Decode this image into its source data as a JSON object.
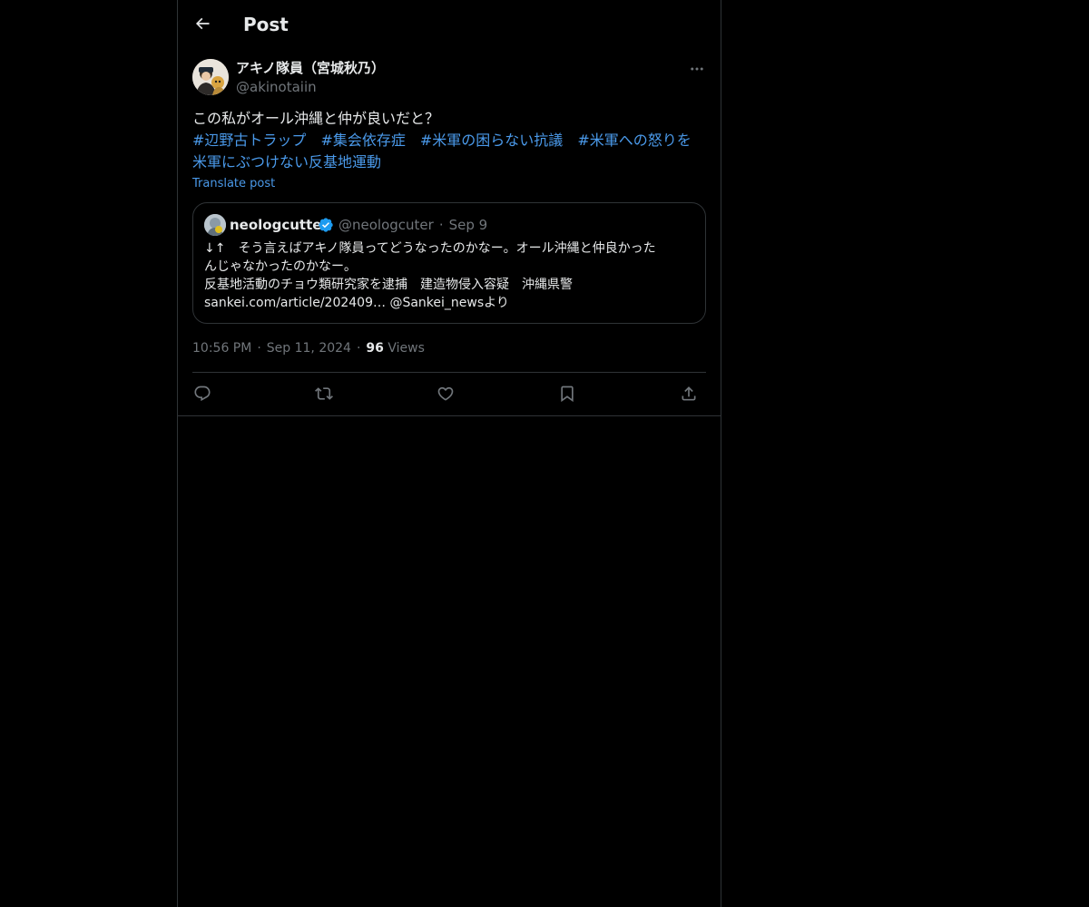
{
  "header": {
    "title": "Post"
  },
  "post": {
    "display_name": "アキノ隊員（宮城秋乃）",
    "handle": "@akinotaiin",
    "text_line1": "この私がオール沖縄と仲が良いだと？",
    "hashtags": [
      "#辺野古トラップ",
      "#集会依存症",
      "#米軍の困らない抗議",
      "#米軍への怒りを米軍にぶつけない反基地運動"
    ],
    "hashtag_last_part1": "#米軍への怒りを",
    "hashtag_last_part2": "米軍にぶつけない反基地運動",
    "translate_label": "Translate post",
    "time": "10:56 PM",
    "date": "Sep 11, 2024",
    "views_count": "96",
    "views_label": "Views"
  },
  "quote": {
    "name": "neologcutter",
    "handle": "@neologcuter",
    "date": "Sep 9",
    "line1": "↓↑　そう言えばアキノ隊員ってどうなったのかなー。オール沖縄と仲良かった",
    "line2": "んじゃなかったのかなー。",
    "line3": "反基地活動のチョウ類研究家を逮捕　建造物侵入容疑　沖縄県警",
    "line4": "sankei.com/article/202409… @Sankei_newsより"
  },
  "icons": {
    "back": "arrow-left-icon",
    "more": "more-horizontal-icon",
    "reply": "reply-icon",
    "repost": "repost-icon",
    "like": "heart-icon",
    "bookmark": "bookmark-icon",
    "share": "share-icon",
    "verified": "verified-badge-icon"
  },
  "colors": {
    "background": "#000000",
    "text": "#e7e9ea",
    "secondary": "#71767b",
    "link": "#4a99e9",
    "border": "#2f3336",
    "verified": "#1d9bf0"
  }
}
